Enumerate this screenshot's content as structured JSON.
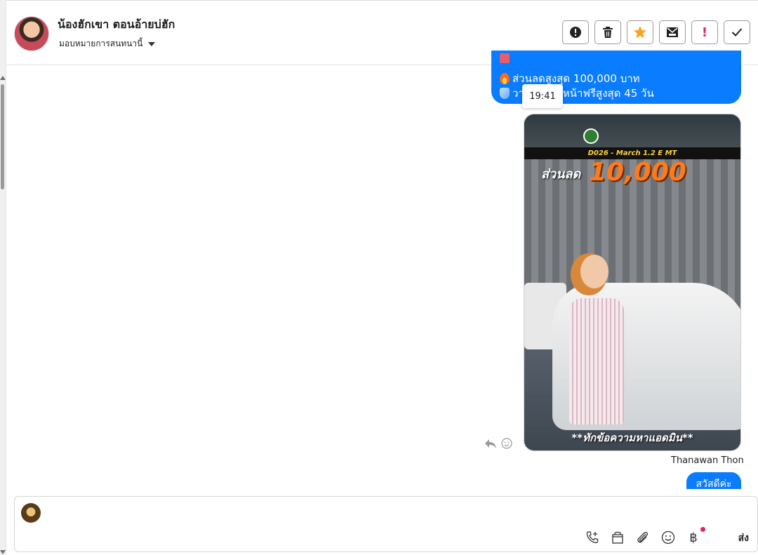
{
  "header": {
    "contact_name": "น้องฮักเขา ตอนอ้ายบ่ฮัก",
    "assign_label": "มอบหมายการสนทนานี้"
  },
  "toolbar": {
    "buttons": [
      {
        "name": "report",
        "icon": "alert-circle-icon",
        "label": "!"
      },
      {
        "name": "delete",
        "icon": "trash-icon"
      },
      {
        "name": "star",
        "icon": "star-icon",
        "color": "#f5a623"
      },
      {
        "name": "mark-unread",
        "icon": "envelope-icon"
      },
      {
        "name": "important",
        "icon": "exclamation-icon",
        "label": "!",
        "color": "#e0245e"
      },
      {
        "name": "done",
        "icon": "check-icon"
      }
    ]
  },
  "conversation": {
    "top_bubble": {
      "lines": [
        "ส่วนลดสูงสุด 100,000 บาท",
        "วางเงินล่วงหน้าฟรีสูงสุด 45 วัน"
      ]
    },
    "tooltip_time": "19:41",
    "media": {
      "model_strip": "D026 - March 1.2 E MT",
      "discount_label": "ส่วนลด",
      "discount_value": "10,000",
      "caption": "**ทักข้อความหาแอดมิน**"
    },
    "sender_name": "Thanawan Thon",
    "last_message": "สวัสดีค่ะ"
  },
  "composer": {
    "value": "",
    "send_label": "ส่ง"
  },
  "colors": {
    "accent": "#0a7cff",
    "star": "#f5a623",
    "important": "#e0245e"
  }
}
